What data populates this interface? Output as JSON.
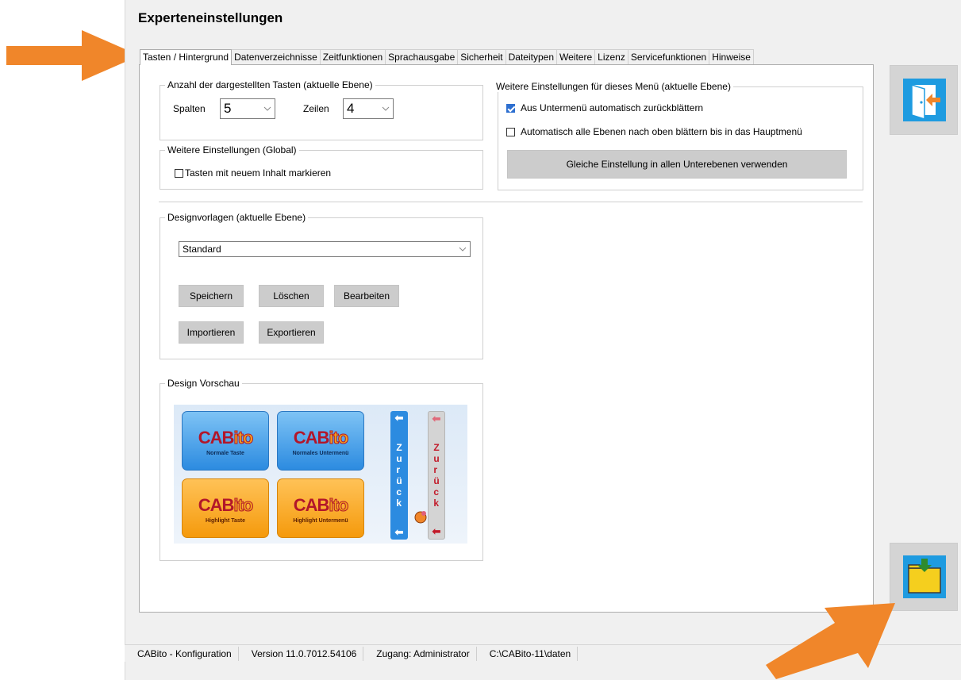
{
  "window": {
    "title": "Experteneinstellungen"
  },
  "tabs": [
    {
      "label": "Tasten / Hintergrund",
      "active": true
    },
    {
      "label": "Datenverzeichnisse"
    },
    {
      "label": "Zeitfunktionen"
    },
    {
      "label": "Sprachausgabe"
    },
    {
      "label": "Sicherheit"
    },
    {
      "label": "Dateitypen"
    },
    {
      "label": "Weitere"
    },
    {
      "label": "Lizenz"
    },
    {
      "label": "Servicefunktionen"
    },
    {
      "label": "Hinweise"
    }
  ],
  "tasten_group": {
    "legend": "Anzahl der dargestellten Tasten (aktuelle Ebene)",
    "spalten_label": "Spalten",
    "spalten_value": "5",
    "zeilen_label": "Zeilen",
    "zeilen_value": "4"
  },
  "global_group": {
    "legend": "Weitere Einstellungen (Global)",
    "mark_label": "Tasten mit neuem Inhalt markieren",
    "mark_checked": false
  },
  "menu_group": {
    "legend": "Weitere Einstellungen für dieses Menü (aktuelle Ebene)",
    "option1_label": "Aus Untermenü automatisch zurückblättern",
    "option1_checked": true,
    "option2_label": "Automatisch alle Ebenen nach oben blättern bis in das Hauptmenü",
    "option2_checked": false,
    "apply_button": "Gleiche Einstellung in allen Unterebenen verwenden"
  },
  "design_group": {
    "legend": "Designvorlagen (aktuelle Ebene)",
    "selected": "Standard",
    "save": "Speichern",
    "delete": "Löschen",
    "edit": "Bearbeiten",
    "import": "Importieren",
    "export": "Exportieren"
  },
  "preview_group": {
    "legend": "Design Vorschau",
    "logo_a": "CAB",
    "logo_b": "ito",
    "normal_key": "Normale Taste",
    "normal_sub": "Normales Untermenü",
    "highlight_key": "Highlight Taste",
    "highlight_sub": "Highlight Untermenü",
    "back_letters": [
      "Z",
      "u",
      "r",
      "ü",
      "c",
      "k"
    ]
  },
  "statusbar": {
    "app": "CABito - Konfiguration",
    "version": "Version 11.0.7012.54106",
    "access": "Zugang: Administrator",
    "path": "C:\\CABito-11\\daten"
  },
  "colors": {
    "annotation_arrow": "#f0862a",
    "accent_blue": "#2c8be0",
    "folder_yellow": "#f5cf1e"
  },
  "icons": {
    "exit": "exit-door-icon",
    "save": "save-folder-icon"
  }
}
